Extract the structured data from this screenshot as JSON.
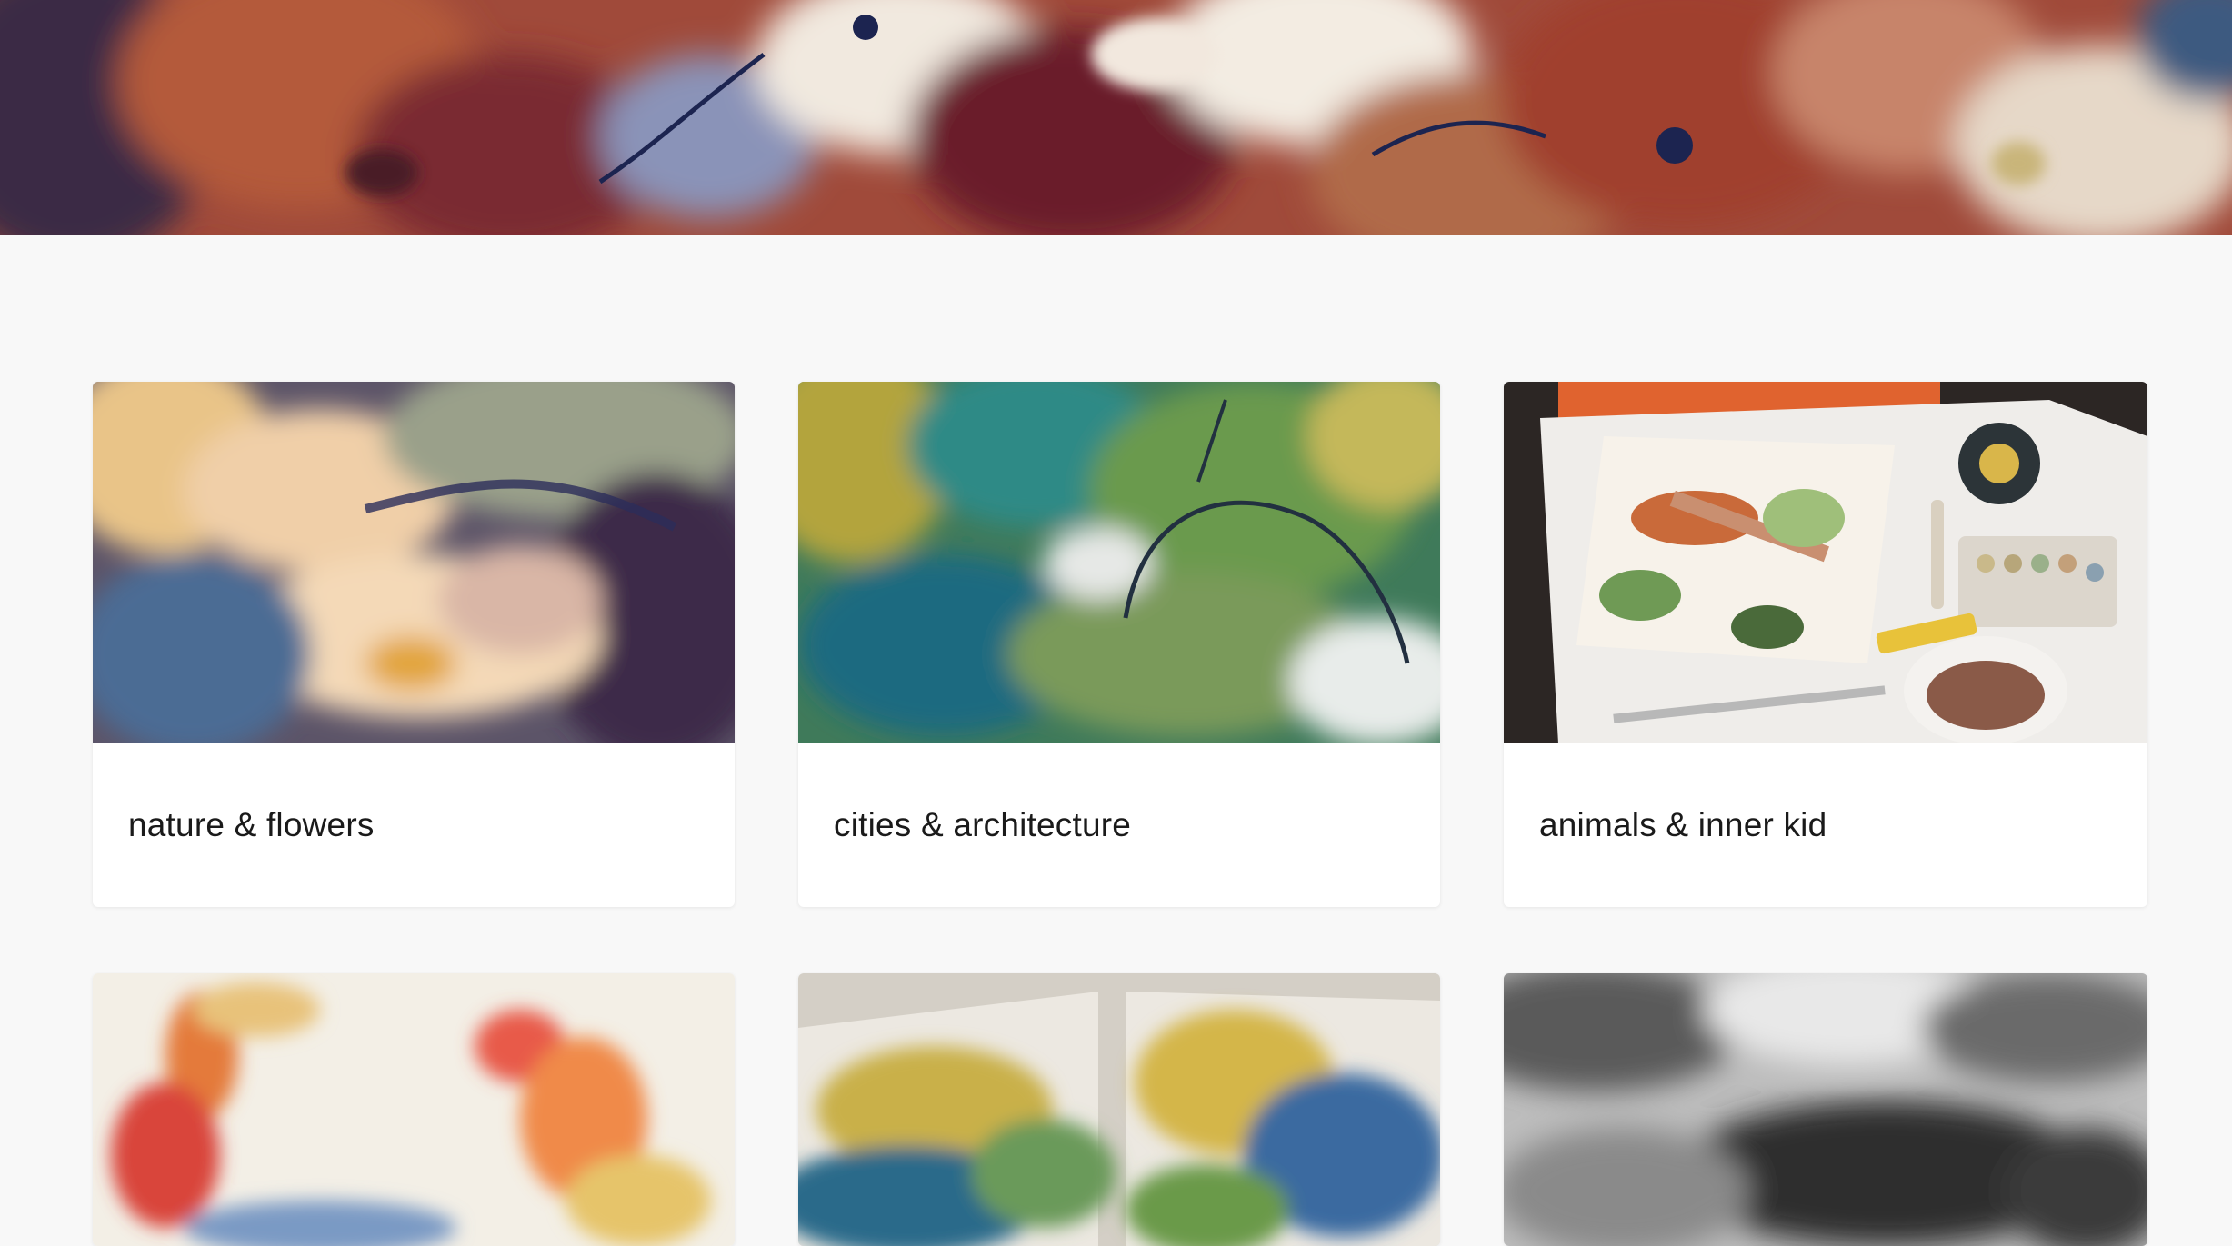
{
  "hero": {
    "icon": "watercolor-banner-image"
  },
  "gallery": {
    "cards": [
      {
        "label": "nature & flowers",
        "image": "watercolor-flower-image"
      },
      {
        "label": "cities & architecture",
        "image": "watercolor-city-image"
      },
      {
        "label": "animals & inner kid",
        "image": "fox-painting-desk-photo"
      },
      {
        "label": "",
        "image": "watercolor-figures-image"
      },
      {
        "label": "",
        "image": "watercolor-landscape-sketchbook-image"
      },
      {
        "label": "",
        "image": "charcoal-drawing-image"
      }
    ]
  },
  "colors": {
    "page_background": "#f8f8f8",
    "card_background": "#ffffff",
    "text": "#1a1a1a"
  }
}
